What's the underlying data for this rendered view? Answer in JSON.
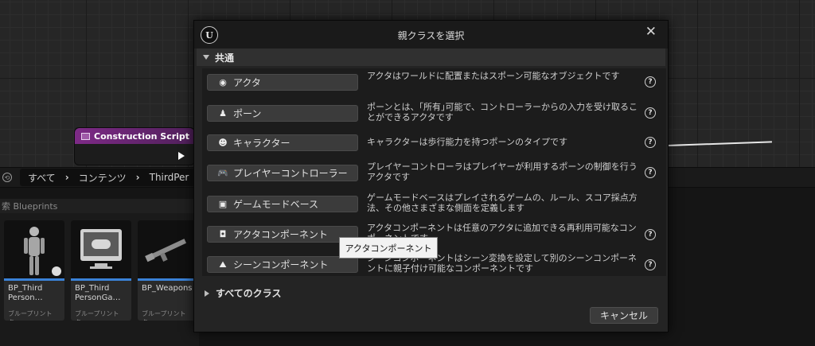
{
  "graph": {
    "node_title": "Construction Script"
  },
  "content_browser": {
    "path": [
      "すべて",
      "コンテンツ",
      "ThirdPer"
    ],
    "search_text": "索 Blueprints",
    "assets": [
      {
        "name": "BP_Third Person…",
        "type": "ブループリント ク…"
      },
      {
        "name": "BP_Third PersonGa…",
        "type": "ブループリント ク…"
      },
      {
        "name": "BP_Weapons",
        "type": "ブループリント ク…"
      }
    ]
  },
  "dialog": {
    "logo": "U",
    "title": "親クラスを選択",
    "close_glyph": "✕",
    "section_label": "共通",
    "classes": [
      {
        "label": "アクタ",
        "icon": "actor-icon",
        "glyph": "◉",
        "desc": "アクタはワールドに配置またはスポーン可能なオブジェクトです"
      },
      {
        "label": "ポーン",
        "icon": "pawn-icon",
        "glyph": "♟",
        "desc": "ポーンとは、｢所有｣可能で、コントローラーからの入力を受け取ることができるアクタです"
      },
      {
        "label": "キャラクター",
        "icon": "character-icon",
        "glyph": "☻",
        "desc": "キャラクターは歩行能力を持つポーンのタイプです"
      },
      {
        "label": "プレイヤーコントローラー",
        "icon": "gamepad-icon",
        "glyph": "🎮",
        "desc": "プレイヤーコントローラはプレイヤーが利用するポーンの制御を行うアクタです"
      },
      {
        "label": "ゲームモードベース",
        "icon": "game-mode-icon",
        "glyph": "▣",
        "desc": "ゲームモードベースはプレイされるゲームの、ルール、スコア採点方法、その他さまざまな側面を定義します"
      },
      {
        "label": "アクタコンポーネント",
        "icon": "actor-component-icon",
        "glyph": "◘",
        "desc": "アクタコンポーネントは任意のアクタに追加できる再利用可能なコンポーネントです"
      },
      {
        "label": "シーンコンポーネント",
        "icon": "scene-component-icon",
        "glyph": "⛰",
        "desc": "シーンコンポーネントはシーン変換を設定して別のシーンコンポーネントに親子付け可能なコンポーネントです"
      }
    ],
    "help_glyph": "?",
    "all_classes_label": "すべてのクラス",
    "cancel_label": "キャンセル"
  },
  "tooltip": {
    "text": "アクタコンポーネント"
  },
  "colors": {
    "accent": "#3a82d8",
    "node_header": "#7d2a86",
    "dialog_bg": "#242424"
  }
}
